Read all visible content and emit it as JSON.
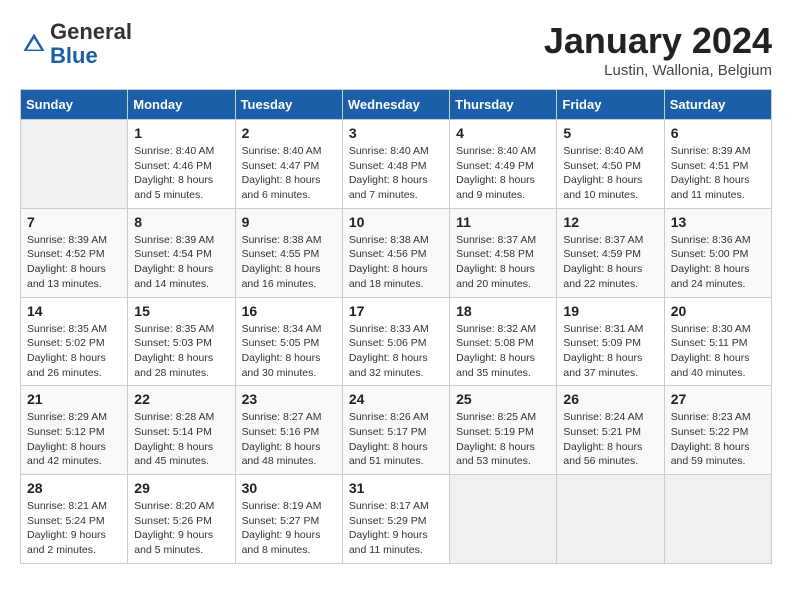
{
  "header": {
    "logo_line1": "General",
    "logo_line2": "Blue",
    "month": "January 2024",
    "location": "Lustin, Wallonia, Belgium"
  },
  "days_of_week": [
    "Sunday",
    "Monday",
    "Tuesday",
    "Wednesday",
    "Thursday",
    "Friday",
    "Saturday"
  ],
  "weeks": [
    [
      {
        "day": "",
        "info": ""
      },
      {
        "day": "1",
        "info": "Sunrise: 8:40 AM\nSunset: 4:46 PM\nDaylight: 8 hours\nand 5 minutes."
      },
      {
        "day": "2",
        "info": "Sunrise: 8:40 AM\nSunset: 4:47 PM\nDaylight: 8 hours\nand 6 minutes."
      },
      {
        "day": "3",
        "info": "Sunrise: 8:40 AM\nSunset: 4:48 PM\nDaylight: 8 hours\nand 7 minutes."
      },
      {
        "day": "4",
        "info": "Sunrise: 8:40 AM\nSunset: 4:49 PM\nDaylight: 8 hours\nand 9 minutes."
      },
      {
        "day": "5",
        "info": "Sunrise: 8:40 AM\nSunset: 4:50 PM\nDaylight: 8 hours\nand 10 minutes."
      },
      {
        "day": "6",
        "info": "Sunrise: 8:39 AM\nSunset: 4:51 PM\nDaylight: 8 hours\nand 11 minutes."
      }
    ],
    [
      {
        "day": "7",
        "info": "Sunrise: 8:39 AM\nSunset: 4:52 PM\nDaylight: 8 hours\nand 13 minutes."
      },
      {
        "day": "8",
        "info": "Sunrise: 8:39 AM\nSunset: 4:54 PM\nDaylight: 8 hours\nand 14 minutes."
      },
      {
        "day": "9",
        "info": "Sunrise: 8:38 AM\nSunset: 4:55 PM\nDaylight: 8 hours\nand 16 minutes."
      },
      {
        "day": "10",
        "info": "Sunrise: 8:38 AM\nSunset: 4:56 PM\nDaylight: 8 hours\nand 18 minutes."
      },
      {
        "day": "11",
        "info": "Sunrise: 8:37 AM\nSunset: 4:58 PM\nDaylight: 8 hours\nand 20 minutes."
      },
      {
        "day": "12",
        "info": "Sunrise: 8:37 AM\nSunset: 4:59 PM\nDaylight: 8 hours\nand 22 minutes."
      },
      {
        "day": "13",
        "info": "Sunrise: 8:36 AM\nSunset: 5:00 PM\nDaylight: 8 hours\nand 24 minutes."
      }
    ],
    [
      {
        "day": "14",
        "info": "Sunrise: 8:35 AM\nSunset: 5:02 PM\nDaylight: 8 hours\nand 26 minutes."
      },
      {
        "day": "15",
        "info": "Sunrise: 8:35 AM\nSunset: 5:03 PM\nDaylight: 8 hours\nand 28 minutes."
      },
      {
        "day": "16",
        "info": "Sunrise: 8:34 AM\nSunset: 5:05 PM\nDaylight: 8 hours\nand 30 minutes."
      },
      {
        "day": "17",
        "info": "Sunrise: 8:33 AM\nSunset: 5:06 PM\nDaylight: 8 hours\nand 32 minutes."
      },
      {
        "day": "18",
        "info": "Sunrise: 8:32 AM\nSunset: 5:08 PM\nDaylight: 8 hours\nand 35 minutes."
      },
      {
        "day": "19",
        "info": "Sunrise: 8:31 AM\nSunset: 5:09 PM\nDaylight: 8 hours\nand 37 minutes."
      },
      {
        "day": "20",
        "info": "Sunrise: 8:30 AM\nSunset: 5:11 PM\nDaylight: 8 hours\nand 40 minutes."
      }
    ],
    [
      {
        "day": "21",
        "info": "Sunrise: 8:29 AM\nSunset: 5:12 PM\nDaylight: 8 hours\nand 42 minutes."
      },
      {
        "day": "22",
        "info": "Sunrise: 8:28 AM\nSunset: 5:14 PM\nDaylight: 8 hours\nand 45 minutes."
      },
      {
        "day": "23",
        "info": "Sunrise: 8:27 AM\nSunset: 5:16 PM\nDaylight: 8 hours\nand 48 minutes."
      },
      {
        "day": "24",
        "info": "Sunrise: 8:26 AM\nSunset: 5:17 PM\nDaylight: 8 hours\nand 51 minutes."
      },
      {
        "day": "25",
        "info": "Sunrise: 8:25 AM\nSunset: 5:19 PM\nDaylight: 8 hours\nand 53 minutes."
      },
      {
        "day": "26",
        "info": "Sunrise: 8:24 AM\nSunset: 5:21 PM\nDaylight: 8 hours\nand 56 minutes."
      },
      {
        "day": "27",
        "info": "Sunrise: 8:23 AM\nSunset: 5:22 PM\nDaylight: 8 hours\nand 59 minutes."
      }
    ],
    [
      {
        "day": "28",
        "info": "Sunrise: 8:21 AM\nSunset: 5:24 PM\nDaylight: 9 hours\nand 2 minutes."
      },
      {
        "day": "29",
        "info": "Sunrise: 8:20 AM\nSunset: 5:26 PM\nDaylight: 9 hours\nand 5 minutes."
      },
      {
        "day": "30",
        "info": "Sunrise: 8:19 AM\nSunset: 5:27 PM\nDaylight: 9 hours\nand 8 minutes."
      },
      {
        "day": "31",
        "info": "Sunrise: 8:17 AM\nSunset: 5:29 PM\nDaylight: 9 hours\nand 11 minutes."
      },
      {
        "day": "",
        "info": ""
      },
      {
        "day": "",
        "info": ""
      },
      {
        "day": "",
        "info": ""
      }
    ]
  ]
}
